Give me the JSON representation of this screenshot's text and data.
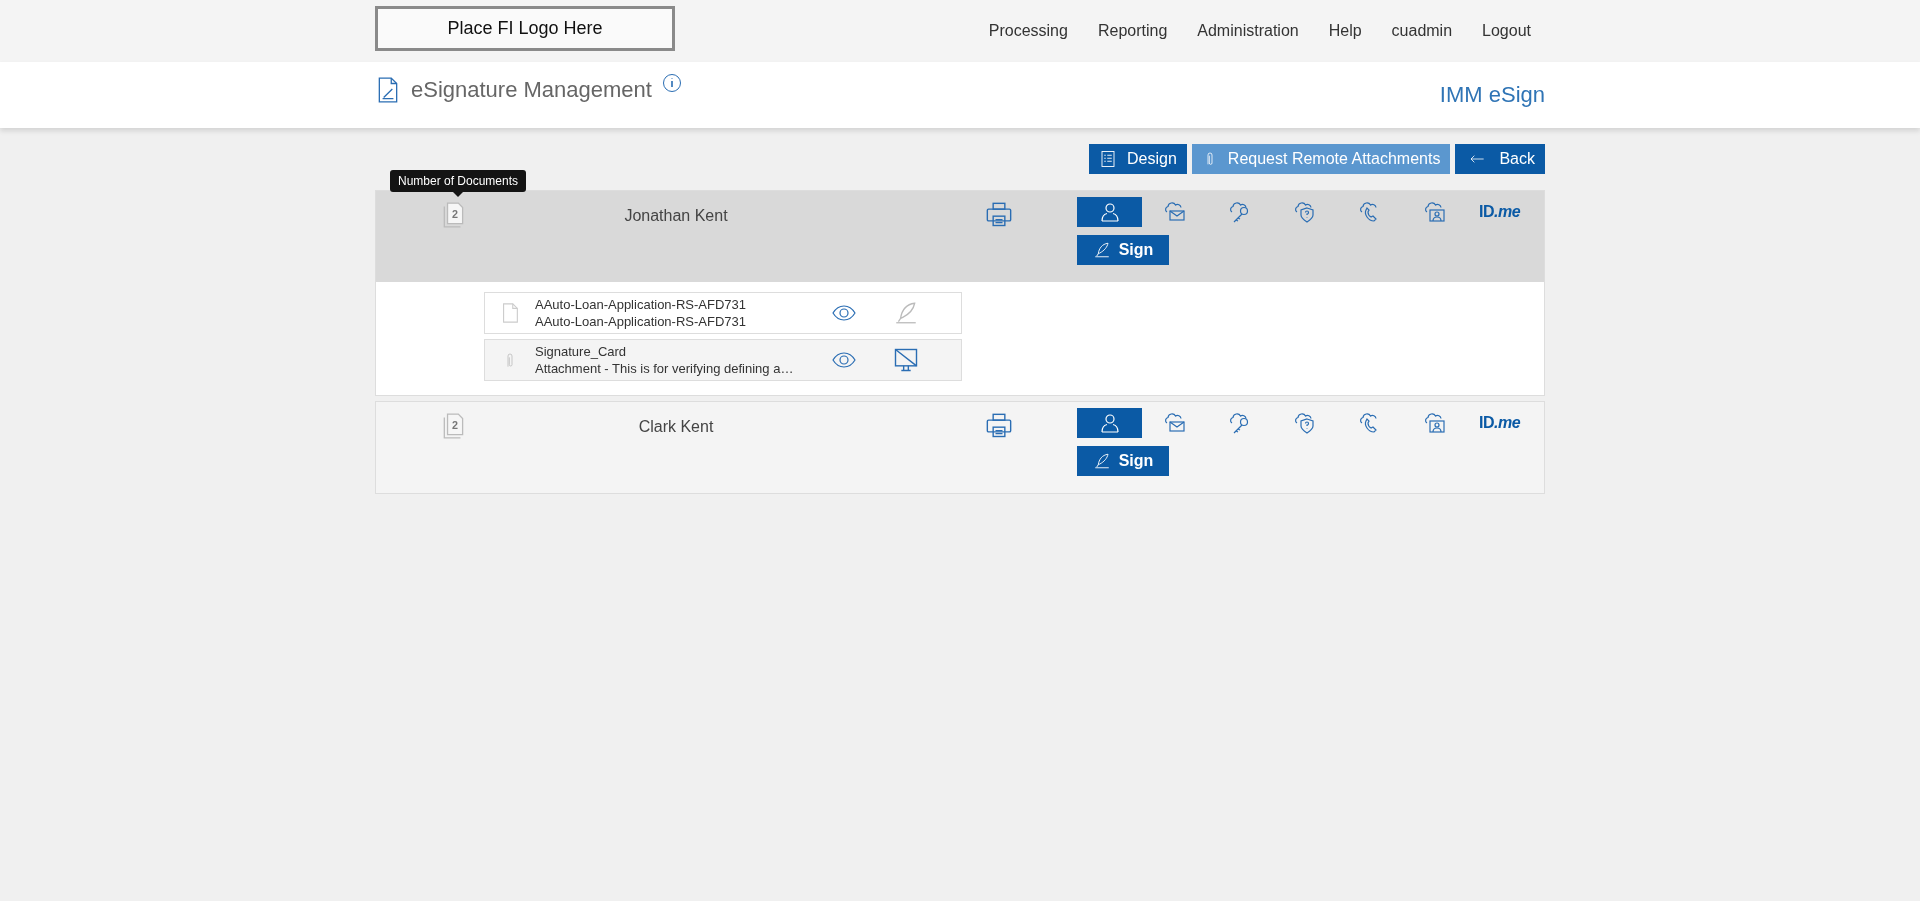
{
  "header": {
    "logo": "Place FI Logo Here",
    "nav": [
      "Processing",
      "Reporting",
      "Administration",
      "Help",
      "cuadmin",
      "Logout"
    ]
  },
  "title_bar": {
    "title": "eSignature Management",
    "product": "IMM eSign"
  },
  "actions": [
    {
      "kind": "design",
      "label": "Design",
      "disabled": false
    },
    {
      "kind": "attach",
      "label": "Request Remote Attachments",
      "disabled": true
    },
    {
      "kind": "back",
      "label": "Back",
      "disabled": false
    }
  ],
  "tooltip": "Number of Documents",
  "signers": [
    {
      "name": "Jonathan Kent",
      "doc_count": "2",
      "expanded": true,
      "sign_label": "Sign",
      "idme_label": "ID",
      "idme_suffix": ".me",
      "auth_methods": [
        {
          "kind": "person",
          "selected": true
        },
        {
          "kind": "email",
          "selected": false
        },
        {
          "kind": "key",
          "selected": false
        },
        {
          "kind": "shield",
          "selected": false
        },
        {
          "kind": "phone",
          "selected": false
        },
        {
          "kind": "video",
          "selected": false
        }
      ],
      "documents": [
        {
          "kind": "document",
          "title": "AAuto-Loan-Application-RS-AFD731",
          "subtitle": "AAuto-Loan-Application-RS-AFD731",
          "action": {
            "kind": "sign",
            "disabled": true
          }
        },
        {
          "kind": "attachment",
          "title": "Signature_Card",
          "subtitle": "Attachment - This is for verifying defining a…",
          "action": {
            "kind": "screen",
            "disabled": false
          }
        }
      ]
    },
    {
      "name": "Clark Kent",
      "doc_count": "2",
      "expanded": false,
      "sign_label": "Sign",
      "idme_label": "ID",
      "idme_suffix": ".me",
      "auth_methods": [
        {
          "kind": "person",
          "selected": true
        },
        {
          "kind": "email",
          "selected": false
        },
        {
          "kind": "key",
          "selected": false
        },
        {
          "kind": "shield",
          "selected": false
        },
        {
          "kind": "phone",
          "selected": false
        },
        {
          "kind": "video",
          "selected": false
        }
      ]
    }
  ]
}
